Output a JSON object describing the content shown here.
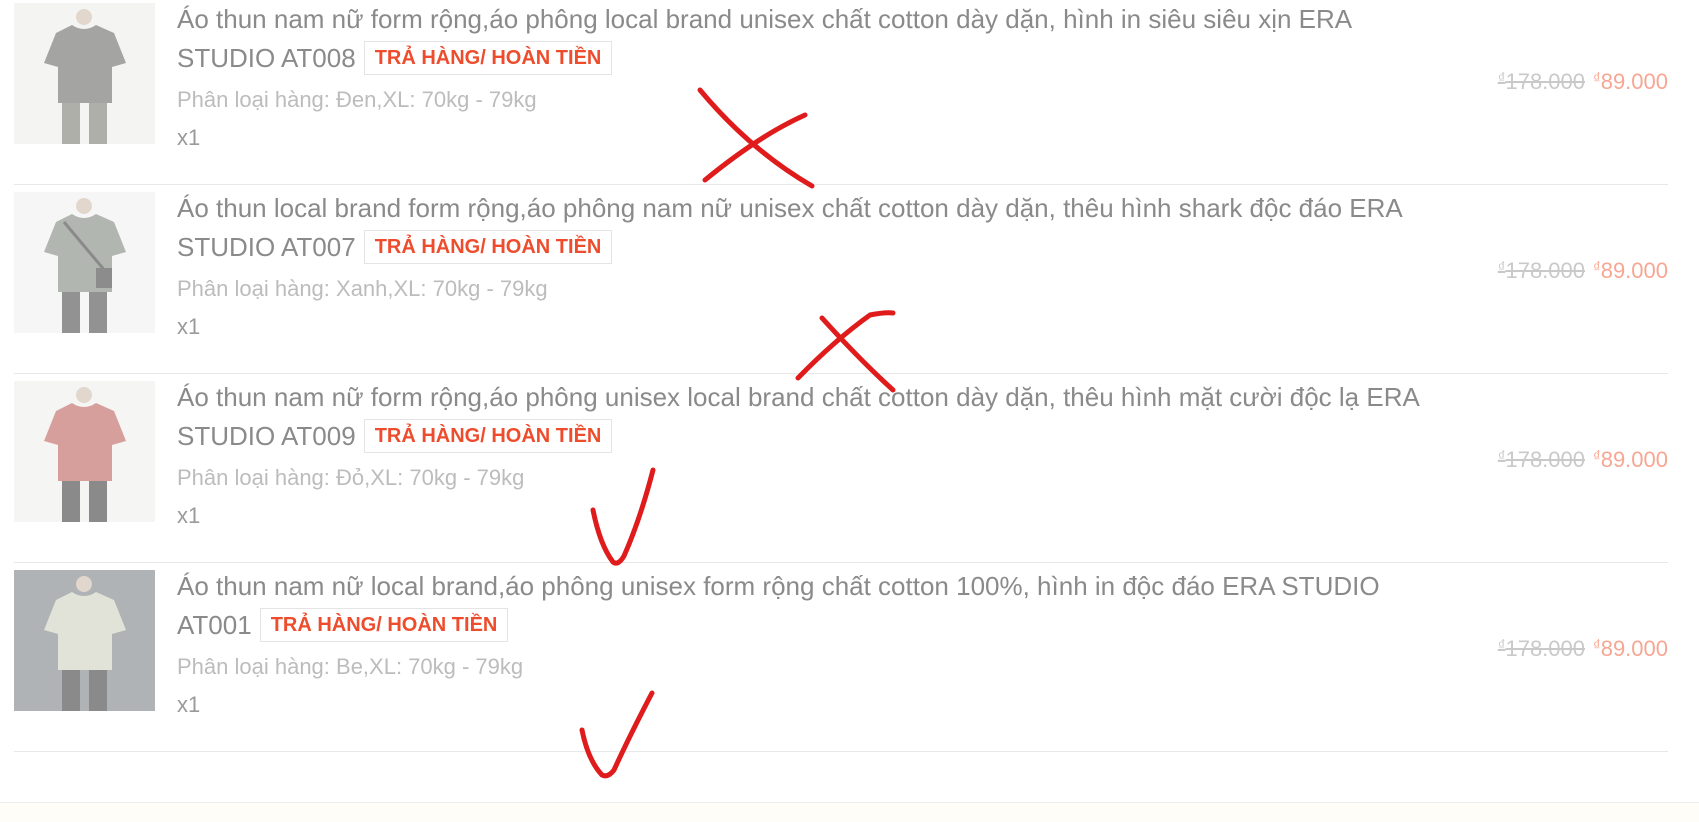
{
  "items": [
    {
      "title": "Áo thun nam nữ form rộng,áo phông local brand unisex chất cotton dày dặn, hình in siêu siêu xịn ERA STUDIO AT008",
      "badge": "TRẢ HÀNG/ HOÀN TIỀN",
      "variant": "Phân loại hàng: Đen,XL: 70kg - 79kg",
      "qty": "x1",
      "currency": "₫",
      "old_price": "178.000",
      "new_price": "89.000",
      "shirt_color": "#5a5a58",
      "mark": "cross"
    },
    {
      "title": "Áo thun local brand form rộng,áo phông nam nữ unisex chất cotton dày dặn, thêu hình shark độc đáo ERA STUDIO AT007",
      "badge": "TRẢ HÀNG/ HOÀN TIỀN",
      "variant": "Phân loại hàng: Xanh,XL: 70kg - 79kg",
      "qty": "x1",
      "currency": "₫",
      "old_price": "178.000",
      "new_price": "89.000",
      "shirt_color": "#737b72",
      "mark": "cross"
    },
    {
      "title": "Áo thun nam nữ form rộng,áo phông unisex local brand chất cotton dày dặn, thêu hình mặt cười độc lạ ERA STUDIO AT009",
      "badge": "TRẢ HÀNG/ HOÀN TIỀN",
      "variant": "Phân loại hàng: Đỏ,XL: 70kg - 79kg",
      "qty": "x1",
      "currency": "₫",
      "old_price": "178.000",
      "new_price": "89.000",
      "shirt_color": "#b8524c",
      "mark": "check"
    },
    {
      "title": "Áo thun nam nữ local brand,áo phông unisex form rộng chất cotton 100%, hình in độc đáo ERA STUDIO AT001",
      "badge": "TRẢ HÀNG/ HOÀN TIỀN",
      "variant": "Phân loại hàng: Be,XL: 70kg - 79kg",
      "qty": "x1",
      "currency": "₫",
      "old_price": "178.000",
      "new_price": "89.000",
      "shirt_color": "#c9ccba",
      "mark": "check"
    }
  ],
  "colors": {
    "badge": "#ee4d2d",
    "price": "#f7a693",
    "annotation": "#e01b1b"
  }
}
